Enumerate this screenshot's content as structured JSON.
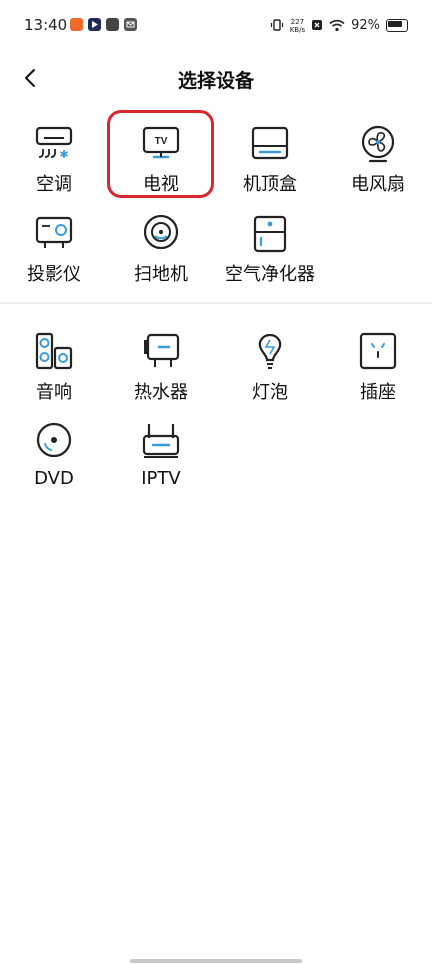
{
  "status_bar": {
    "time": "13:40",
    "notif_colors": [
      "#f0692d",
      "#1e2a5a",
      "#444444",
      "#555555"
    ],
    "net_speed_value": "227",
    "net_speed_unit": "KB/s",
    "battery": "92%"
  },
  "header": {
    "title": "选择设备",
    "back_icon": "chevron-left-icon"
  },
  "section1": [
    {
      "label": "空调",
      "icon": "air-conditioner-icon"
    },
    {
      "label": "电视",
      "icon": "tv-icon",
      "selected": true
    },
    {
      "label": "机顶盒",
      "icon": "set-top-box-icon"
    },
    {
      "label": "电风扇",
      "icon": "fan-icon"
    },
    {
      "label": "投影仪",
      "icon": "projector-icon"
    },
    {
      "label": "扫地机",
      "icon": "robot-vacuum-icon"
    },
    {
      "label": "空气净化器",
      "icon": "air-purifier-icon"
    }
  ],
  "section2": [
    {
      "label": "音响",
      "icon": "speaker-icon"
    },
    {
      "label": "热水器",
      "icon": "water-heater-icon"
    },
    {
      "label": "灯泡",
      "icon": "light-bulb-icon"
    },
    {
      "label": "插座",
      "icon": "socket-icon"
    },
    {
      "label": "DVD",
      "icon": "dvd-icon"
    },
    {
      "label": "IPTV",
      "icon": "iptv-icon"
    }
  ],
  "tv_badge": "TV",
  "colors": {
    "accent": "#3a9bd9",
    "highlight": "#d9272e",
    "icon_stroke": "#222222"
  }
}
